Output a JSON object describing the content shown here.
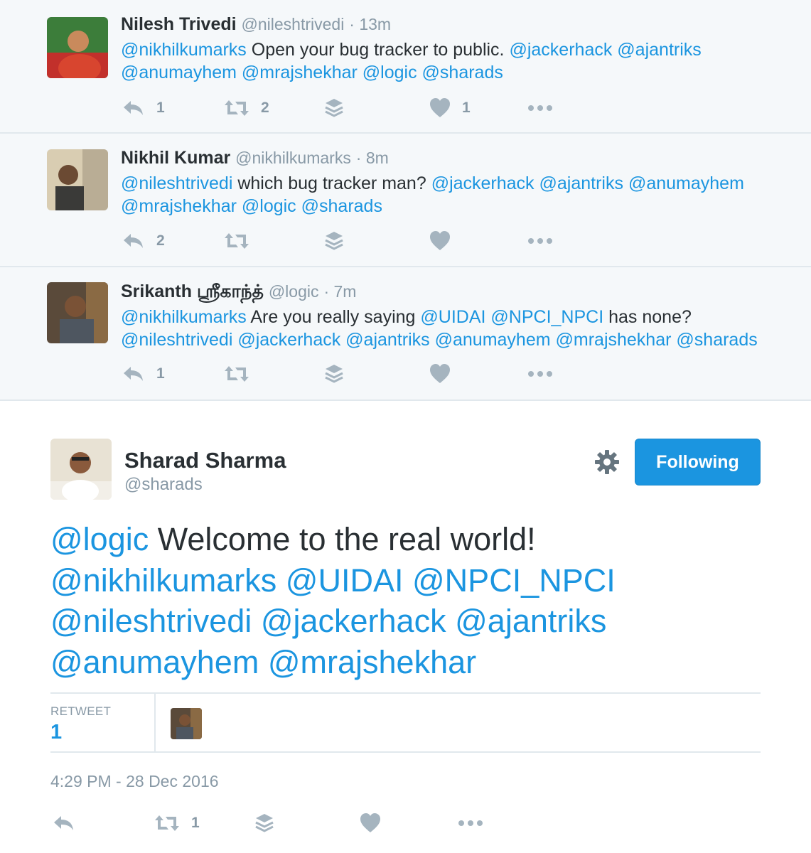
{
  "colors": {
    "accent": "#1b95e0",
    "muted": "#8899a6",
    "text": "#292f33",
    "reply_bg": "#f5f8fa",
    "border": "#e1e8ed"
  },
  "replies": [
    {
      "name": "Nilesh Trivedi",
      "handle": "@nileshtrivedi",
      "time": "· 13m",
      "text_segments": [
        {
          "t": "@nikhilkumarks",
          "m": true
        },
        {
          "t": " Open your bug tracker to public. ",
          "m": false
        },
        {
          "t": "@jackerhack",
          "m": true
        },
        {
          "t": " ",
          "m": false
        },
        {
          "t": "@ajantriks",
          "m": true
        },
        {
          "t": " ",
          "m": false
        },
        {
          "t": "@anumayhem",
          "m": true
        },
        {
          "t": " ",
          "m": false
        },
        {
          "t": "@mrajshekhar",
          "m": true
        },
        {
          "t": " ",
          "m": false
        },
        {
          "t": "@logic",
          "m": true
        },
        {
          "t": " ",
          "m": false
        },
        {
          "t": "@sharads",
          "m": true
        }
      ],
      "reply_count": "1",
      "retweet_count": "2",
      "like_count": "1"
    },
    {
      "name": "Nikhil Kumar",
      "handle": "@nikhilkumarks",
      "time": "· 8m",
      "text_segments": [
        {
          "t": "@nileshtrivedi",
          "m": true
        },
        {
          "t": " which bug tracker man?  ",
          "m": false
        },
        {
          "t": "@jackerhack",
          "m": true
        },
        {
          "t": " ",
          "m": false
        },
        {
          "t": "@ajantriks",
          "m": true
        },
        {
          "t": " ",
          "m": false
        },
        {
          "t": "@anumayhem",
          "m": true
        },
        {
          "t": " ",
          "m": false
        },
        {
          "t": "@mrajshekhar",
          "m": true
        },
        {
          "t": " ",
          "m": false
        },
        {
          "t": "@logic",
          "m": true
        },
        {
          "t": " ",
          "m": false
        },
        {
          "t": "@sharads",
          "m": true
        }
      ],
      "reply_count": "2",
      "retweet_count": "",
      "like_count": ""
    },
    {
      "name": "Srikanth ஸ்ரீகாந்த்",
      "handle": "@logic",
      "time": "· 7m",
      "text_segments": [
        {
          "t": "@nikhilkumarks",
          "m": true
        },
        {
          "t": " Are you really saying ",
          "m": false
        },
        {
          "t": "@UIDAI",
          "m": true
        },
        {
          "t": " ",
          "m": false
        },
        {
          "t": "@NPCI_NPCI",
          "m": true
        },
        {
          "t": "  has none? ",
          "m": false
        },
        {
          "t": "@nileshtrivedi",
          "m": true
        },
        {
          "t": " ",
          "m": false
        },
        {
          "t": "@jackerhack",
          "m": true
        },
        {
          "t": " ",
          "m": false
        },
        {
          "t": "@ajantriks",
          "m": true
        },
        {
          "t": " ",
          "m": false
        },
        {
          "t": "@anumayhem",
          "m": true
        },
        {
          "t": " ",
          "m": false
        },
        {
          "t": "@mrajshekhar",
          "m": true
        },
        {
          "t": " ",
          "m": false
        },
        {
          "t": "@sharads",
          "m": true
        }
      ],
      "reply_count": "1",
      "retweet_count": "",
      "like_count": ""
    }
  ],
  "main": {
    "name": "Sharad Sharma",
    "handle": "@sharads",
    "follow_label": "Following",
    "text_segments": [
      {
        "t": "@logic",
        "m": true
      },
      {
        "t": " Welcome to the real world! ",
        "m": false
      },
      {
        "t": "@nikhilkumarks",
        "m": true
      },
      {
        "t": " ",
        "m": false
      },
      {
        "t": "@UIDAI",
        "m": true
      },
      {
        "t": " ",
        "m": false
      },
      {
        "t": "@NPCI_NPCI",
        "m": true
      },
      {
        "t": " ",
        "m": false
      },
      {
        "t": "@nileshtrivedi",
        "m": true
      },
      {
        "t": " ",
        "m": false
      },
      {
        "t": "@jackerhack",
        "m": true
      },
      {
        "t": " ",
        "m": false
      },
      {
        "t": "@ajantriks",
        "m": true
      },
      {
        "t": " ",
        "m": false
      },
      {
        "t": "@anumayhem",
        "m": true
      },
      {
        "t": " ",
        "m": false
      },
      {
        "t": "@mrajshekhar",
        "m": true
      }
    ],
    "retweet_label": "RETWEET",
    "retweet_count": "1",
    "timestamp": "4:29 PM - 28 Dec 2016",
    "action_retweet_count": "1"
  }
}
